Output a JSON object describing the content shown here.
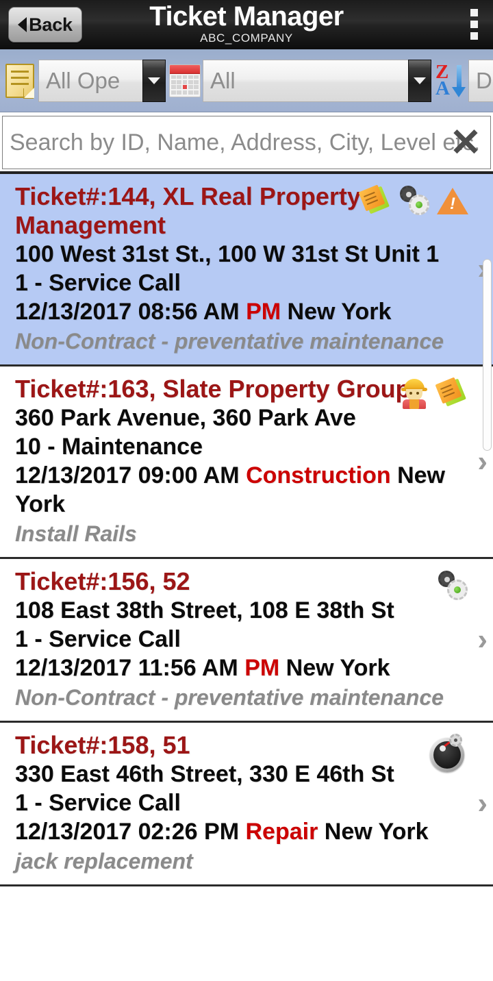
{
  "header": {
    "back_label": "Back",
    "title": "Ticket Manager",
    "subtitle": "ABC_COMPANY",
    "overflow_icon": "more-vertical-icon"
  },
  "filters": {
    "status": {
      "icon": "document-icon",
      "value": "All Ope",
      "full_value": "All Open"
    },
    "date": {
      "icon": "calendar-icon",
      "value": "All"
    },
    "sort": {
      "icon": "sort-za-icon",
      "value": "Date"
    }
  },
  "search": {
    "placeholder": "Search by ID, Name, Address, City, Level etc.",
    "value": "",
    "clear_label": "✕"
  },
  "tickets": [
    {
      "title": "Ticket#:144, XL Real Property Management",
      "address": "100 West 31st St., 100 W 31st St Unit 1",
      "type": "1 - Service Call",
      "datetime": "12/13/2017 08:56 AM",
      "category": "PM",
      "city": "New York",
      "note": "Non-Contract - preventative maintenance",
      "selected": true,
      "icons": [
        "note-icon",
        "gears-icon",
        "warning-icon"
      ],
      "chevron": "›"
    },
    {
      "title": "Ticket#:163, Slate Property Group",
      "address": "360 Park Avenue, 360 Park Ave",
      "type": "10 - Maintenance",
      "datetime": "12/13/2017 09:00 AM",
      "category": "Construction",
      "city": "New York",
      "note": "Install Rails",
      "selected": false,
      "icons": [
        "worker-icon",
        "note-icon"
      ],
      "chevron": "›"
    },
    {
      "title": "Ticket#:156, 52",
      "address": "108 East 38th Street, 108 E 38th St",
      "type": "1 - Service Call",
      "datetime": "12/13/2017 11:56 AM",
      "category": "PM",
      "city": "New York",
      "note": "Non-Contract - preventative maintenance",
      "selected": false,
      "icons": [
        "gears-icon"
      ],
      "chevron": "›"
    },
    {
      "title": "Ticket#:158, 51",
      "address": "330 East 46th Street, 330 E 46th St",
      "type": "1 - Service Call",
      "datetime": "12/13/2017 02:26 PM",
      "category": "Repair",
      "city": "New York",
      "note": "jack replacement",
      "selected": false,
      "icons": [
        "gauge-icon"
      ],
      "chevron": "›"
    }
  ],
  "colors": {
    "title_red": "#9c1616",
    "highlight_red": "#cc0000",
    "selected_row": "#b6caf4",
    "toolbar_blue": "#a9b9d6",
    "note_gray": "#8a8a8a"
  }
}
